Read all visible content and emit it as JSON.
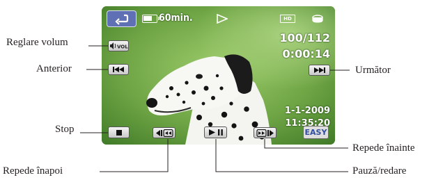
{
  "screen": {
    "remaining_time": "60min.",
    "counter": "100/112",
    "timecode": "0:00:14",
    "date": "1-1-2009",
    "time": "11:35:20",
    "hd_badge": "HD",
    "easy_label": "EASY",
    "vol_label": "VOL"
  },
  "callouts": {
    "volume": "Reglare volum",
    "previous": "Anterior",
    "next": "Următor",
    "stop": "Stop",
    "fast_forward": "Repede înainte",
    "rewind": "Repede înapoi",
    "play_pause": "Pauză/redare"
  },
  "icons": [
    "return-icon",
    "battery-icon",
    "play-indicator-icon",
    "hd-icon",
    "media-icon",
    "volume-icon",
    "previous-icon",
    "next-icon",
    "stop-icon",
    "rewind-icon",
    "play-pause-icon",
    "fast-forward-icon"
  ],
  "colors": {
    "back_button": "#5f70b4",
    "easy_text": "#304da0",
    "button_face": "#e6e6e6"
  }
}
